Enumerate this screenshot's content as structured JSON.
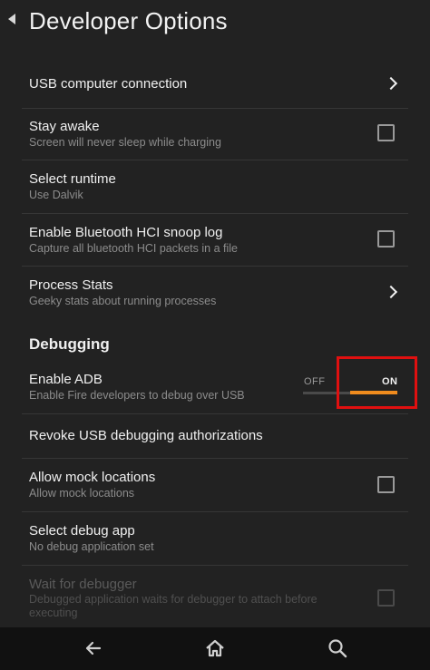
{
  "header": {
    "title": "Developer Options"
  },
  "settings": [
    {
      "label": "USB computer connection",
      "control": "chevron"
    },
    {
      "label": "Stay awake",
      "sub": "Screen will never sleep while charging",
      "control": "checkbox",
      "checked": false
    },
    {
      "label": "Select runtime",
      "sub": "Use Dalvik"
    },
    {
      "label": "Enable Bluetooth HCI snoop log",
      "sub": "Capture all bluetooth HCI packets in a file",
      "control": "checkbox",
      "checked": false
    },
    {
      "label": "Process Stats",
      "sub": "Geeky stats about running processes",
      "control": "chevron"
    }
  ],
  "debugging": {
    "section_title": "Debugging",
    "items": [
      {
        "label": "Enable ADB",
        "sub": "Enable Fire developers to debug over USB",
        "control": "toggle",
        "toggle_off_label": "OFF",
        "toggle_on_label": "ON",
        "state": "on"
      },
      {
        "label": "Revoke USB debugging authorizations"
      },
      {
        "label": "Allow mock locations",
        "sub": "Allow mock locations",
        "control": "checkbox",
        "checked": false
      },
      {
        "label": "Select debug app",
        "sub": "No debug application set"
      },
      {
        "label": "Wait for debugger",
        "sub": "Debugged application waits for debugger to attach before executing",
        "control": "checkbox",
        "checked": false,
        "enabled": false
      }
    ]
  },
  "colors": {
    "background": "#222222",
    "accent": "#f08c1e",
    "highlight": "#e01010",
    "navbar": "#111111"
  },
  "navbar": {
    "icons": [
      "back-arrow-icon",
      "home-icon",
      "search-icon"
    ]
  }
}
